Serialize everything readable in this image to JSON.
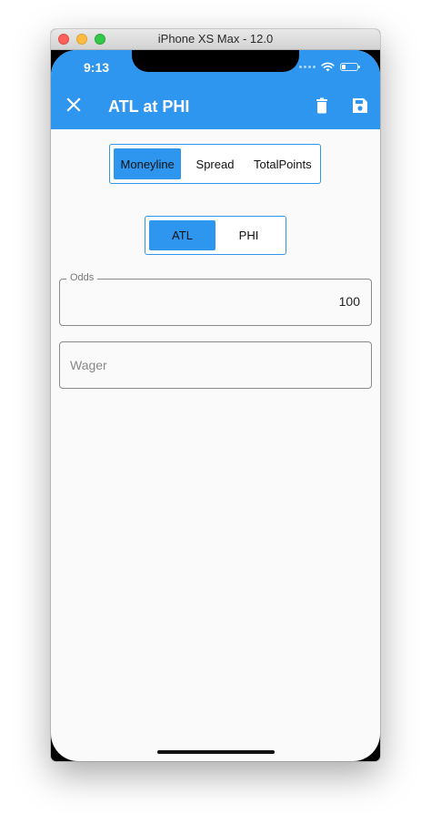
{
  "simulator": {
    "title": "iPhone XS Max - 12.0"
  },
  "status_bar": {
    "time": "9:13",
    "battery_level": 0.25
  },
  "app_bar": {
    "title": "ATL at PHI",
    "background": "#2f96f0",
    "icons": [
      "close-icon",
      "delete-icon",
      "save-icon"
    ]
  },
  "bet_type": {
    "options": [
      "Moneyline",
      "Spread",
      "TotalPoints"
    ],
    "selected": "Moneyline"
  },
  "team": {
    "options": [
      "ATL",
      "PHI"
    ],
    "selected": "ATL"
  },
  "odds_field": {
    "label": "Odds",
    "value": "100"
  },
  "wager_field": {
    "placeholder": "Wager",
    "value": ""
  }
}
